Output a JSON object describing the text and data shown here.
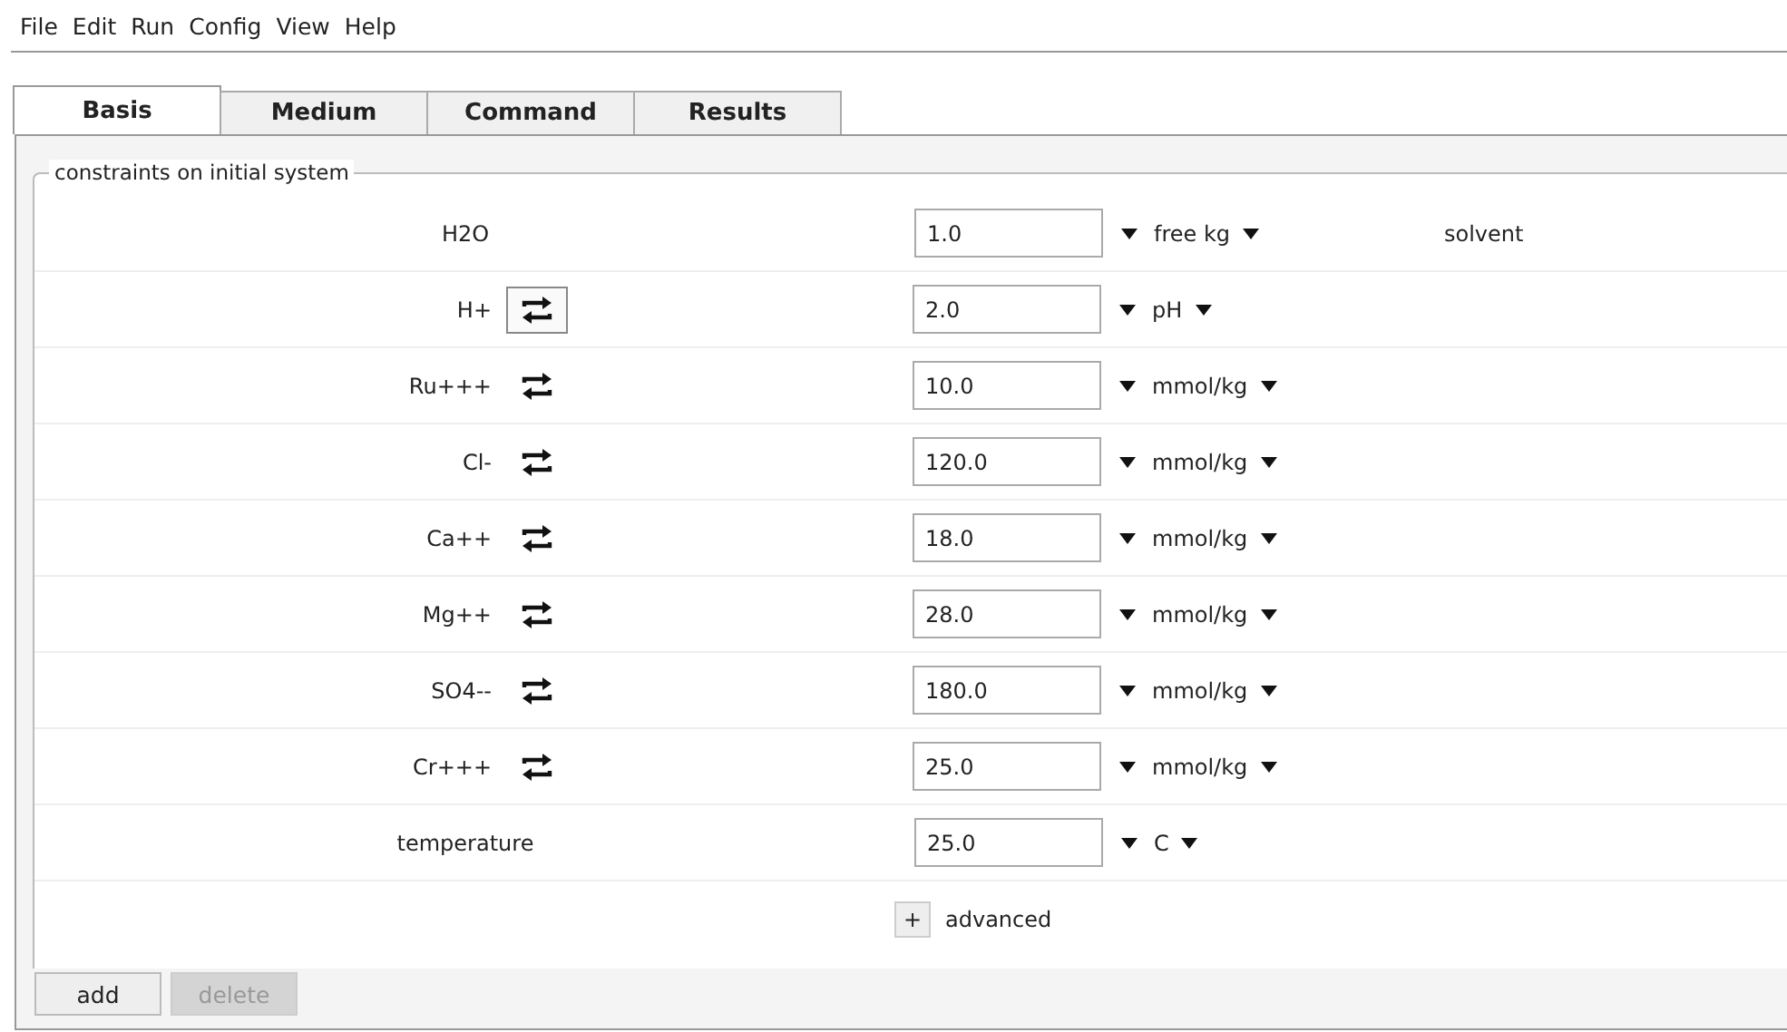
{
  "menu": [
    "File",
    "Edit",
    "Run",
    "Config",
    "View",
    "Help"
  ],
  "tabs": [
    {
      "label": "Basis",
      "selected": true
    },
    {
      "label": "Medium",
      "selected": false
    },
    {
      "label": "Command",
      "selected": false
    },
    {
      "label": "Results",
      "selected": false
    }
  ],
  "group": {
    "title": "constraints on initial system",
    "rows": [
      {
        "kind": "plain",
        "label": "H2O",
        "value": "1.0",
        "unit": "free kg",
        "note": "solvent"
      },
      {
        "kind": "swap",
        "label": "H+",
        "swap_focused": true,
        "value": "2.0",
        "unit": "pH"
      },
      {
        "kind": "swap",
        "label": "Ru+++",
        "swap_focused": false,
        "value": "10.0",
        "unit": "mmol/kg"
      },
      {
        "kind": "swap",
        "label": "Cl-",
        "swap_focused": false,
        "value": "120.0",
        "unit": "mmol/kg"
      },
      {
        "kind": "swap",
        "label": "Ca++",
        "swap_focused": false,
        "value": "18.0",
        "unit": "mmol/kg"
      },
      {
        "kind": "swap",
        "label": "Mg++",
        "swap_focused": false,
        "value": "28.0",
        "unit": "mmol/kg"
      },
      {
        "kind": "swap",
        "label": "SO4--",
        "swap_focused": false,
        "value": "180.0",
        "unit": "mmol/kg"
      },
      {
        "kind": "swap",
        "label": "Cr+++",
        "swap_focused": false,
        "value": "25.0",
        "unit": "mmol/kg"
      },
      {
        "kind": "plain",
        "label": "temperature",
        "value": "25.0",
        "unit": "C"
      }
    ],
    "advanced": {
      "toggle": "+",
      "label": "advanced",
      "expanded": false
    }
  },
  "buttons": [
    {
      "label": "add",
      "disabled": false
    },
    {
      "label": "delete",
      "disabled": true
    }
  ]
}
